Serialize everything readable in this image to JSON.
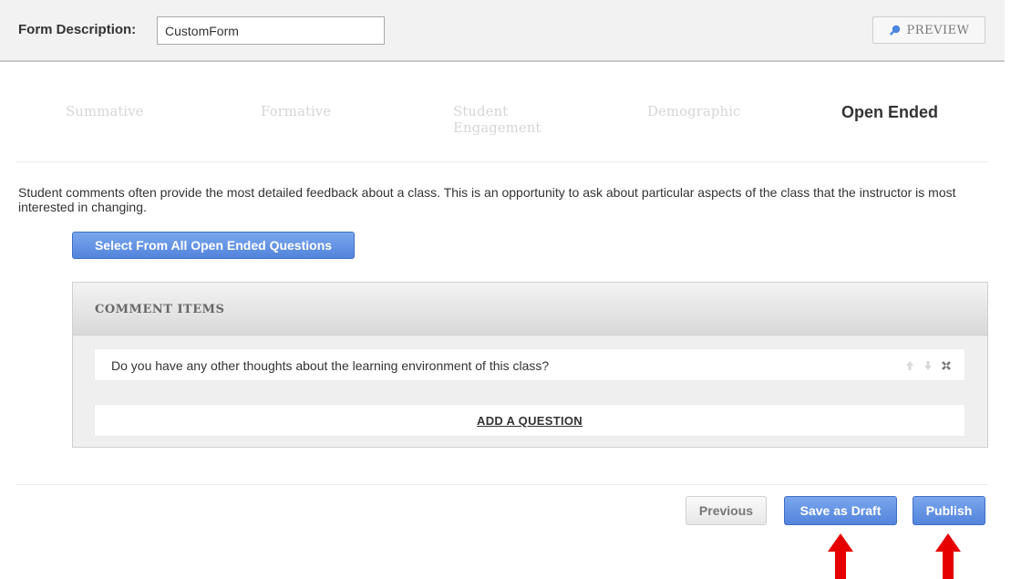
{
  "form": {
    "description_label": "Form Description:",
    "description_value": "CustomForm",
    "preview_label": "PREVIEW"
  },
  "steps": [
    {
      "label": "Summative",
      "state": "inactive"
    },
    {
      "label": "Formative",
      "state": "inactive"
    },
    {
      "label": "Student Engagement",
      "line1": "Student",
      "line2": "Engagement",
      "state": "inactive"
    },
    {
      "label": "Demographic",
      "state": "inactive"
    },
    {
      "label": "Open Ended",
      "state": "active"
    }
  ],
  "intro_text": "Student comments often provide the most detailed feedback about a class. This is an opportunity to ask about particular aspects of the class that the instructor is most interested in changing.",
  "select_all_label": "Select From All Open Ended Questions",
  "comment_panel": {
    "title": "COMMENT ITEMS",
    "items": [
      {
        "text": "Do you have any other thoughts about the learning environment of this class?"
      }
    ],
    "add_question_label": "ADD A QUESTION"
  },
  "footer": {
    "previous_label": "Previous",
    "save_draft_label": "Save as Draft",
    "publish_label": "Publish"
  },
  "colors": {
    "primary_button": "#5b8ce0",
    "annotation_arrow": "#e60000"
  },
  "icons": [
    "search-icon",
    "arrow-up-icon",
    "arrow-down-icon",
    "remove-icon",
    "red-arrow-up-icon"
  ]
}
